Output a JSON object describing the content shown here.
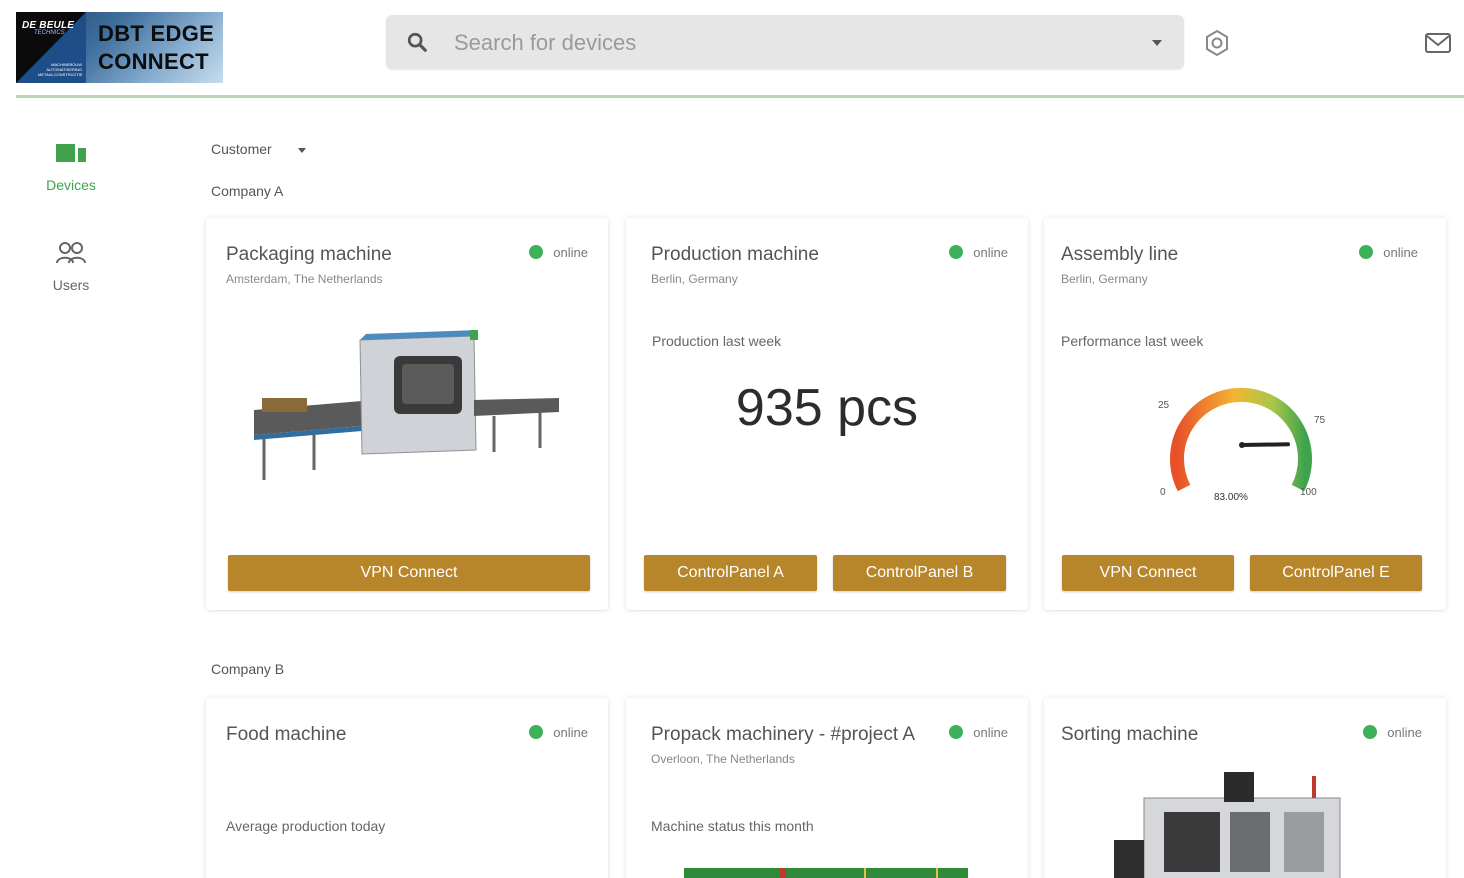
{
  "app": {
    "logo": {
      "brand": "DE BEULE",
      "brand_sub": "TECHNICS",
      "brand_tag": "MACHINEBOUW AUTOMATISERING METAALCONSTRUCTIE",
      "line1": "DBT EDGE",
      "line2": "CONNECT"
    },
    "search": {
      "placeholder": "Search for devices"
    },
    "icons": {
      "search": "search-icon",
      "settings": "settings-icon",
      "mail": "mail-icon"
    }
  },
  "sidebar": {
    "items": [
      {
        "label": "Devices",
        "icon": "devices-icon",
        "active": true
      },
      {
        "label": "Users",
        "icon": "users-icon",
        "active": false
      }
    ]
  },
  "filter": {
    "label": "Customer"
  },
  "groups": [
    {
      "name": "Company A",
      "cards": [
        {
          "title": "Packaging machine",
          "location": "Amsterdam, The Netherlands",
          "status": "online",
          "buttons": [
            "VPN Connect"
          ]
        },
        {
          "title": "Production machine",
          "location": "Berlin, Germany",
          "status": "online",
          "metric_label": "Production last week",
          "metric_value": "935 pcs",
          "buttons": [
            "ControlPanel A",
            "ControlPanel B"
          ]
        },
        {
          "title": "Assembly line",
          "location": "Berlin, Germany",
          "status": "online",
          "metric_label": "Performance last week",
          "gauge": {
            "value": 83,
            "value_label": "83.00%",
            "ticks": [
              "0",
              "25",
              "75",
              "100"
            ]
          },
          "buttons": [
            "VPN Connect",
            "ControlPanel E"
          ]
        }
      ]
    },
    {
      "name": "Company B",
      "cards": [
        {
          "title": "Food machine",
          "location": "",
          "status": "online",
          "metric_label": "Average production today"
        },
        {
          "title": "Propack machinery - #project A",
          "location": "Overloon, The Netherlands",
          "status": "online",
          "metric_label": "Machine status this month"
        },
        {
          "title": "Sorting machine",
          "location": "",
          "status": "online"
        }
      ]
    }
  ],
  "colors": {
    "accent_green": "#3fa34d",
    "status_green": "#3fb05a",
    "button_gold": "#b7862a",
    "header_divider": "#b7d9b0"
  }
}
